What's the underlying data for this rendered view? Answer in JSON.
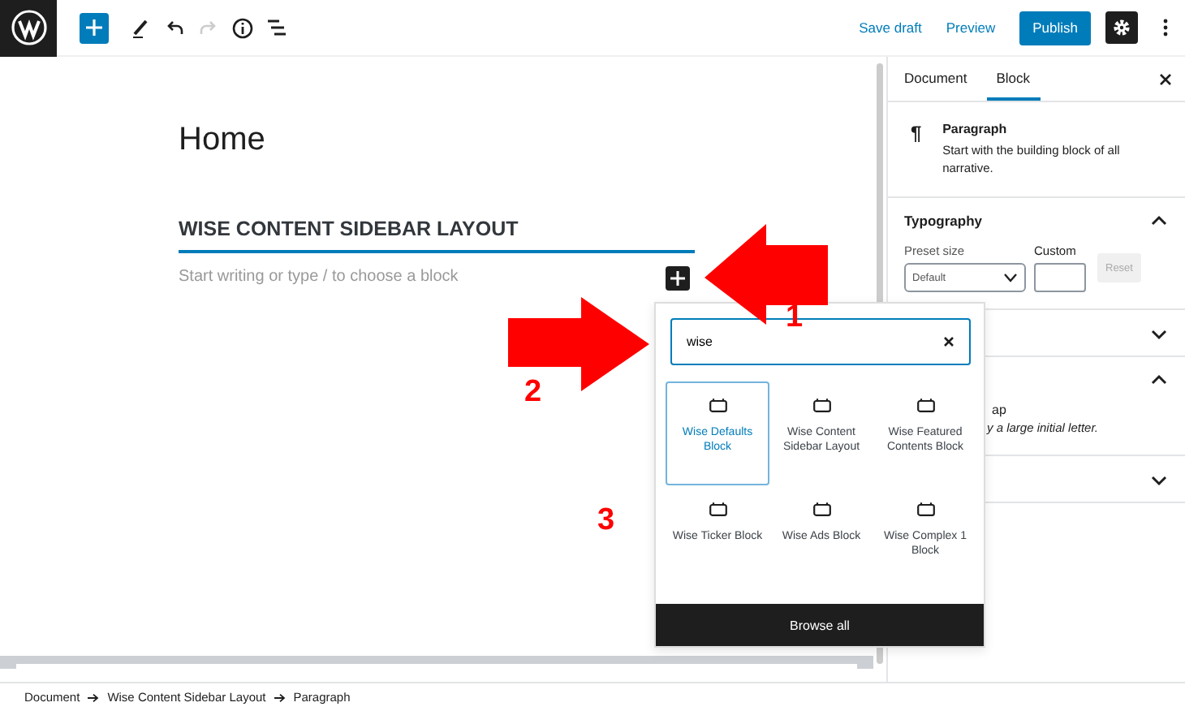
{
  "toolbar": {
    "undo_disabled": false,
    "redo_disabled": true,
    "save_draft": "Save draft",
    "preview": "Preview",
    "publish": "Publish",
    "settings_on": true
  },
  "editor": {
    "title": "Home",
    "heading": "WISE CONTENT SIDEBAR LAYOUT",
    "placeholder": "Start writing or type / to choose a block"
  },
  "inserter": {
    "search": {
      "value": "wise"
    },
    "blocks": [
      {
        "label": "Wise Defaults Block",
        "selected": true
      },
      {
        "label": "Wise Content Sidebar Layout",
        "selected": false
      },
      {
        "label": "Wise Featured Contents Block",
        "selected": false
      },
      {
        "label": "Wise Ticker Block",
        "selected": false
      },
      {
        "label": "Wise Ads Block",
        "selected": false
      },
      {
        "label": "Wise Complex 1 Block",
        "selected": false
      }
    ],
    "browse_all": "Browse all"
  },
  "sidebar": {
    "tabs": [
      {
        "label": "Document",
        "selected": false
      },
      {
        "label": "Block",
        "selected": true
      }
    ],
    "block": {
      "icon": "¶",
      "name": "Paragraph",
      "description": "Start with the building block of all narrative."
    },
    "panels": [
      {
        "kind": "typography",
        "title": "Typography",
        "expanded": true,
        "preset_label": "Preset size",
        "preset_value": "Default",
        "custom_label": "Custom",
        "reset": "Reset",
        "reset_disabled": true
      },
      {
        "kind": "plain",
        "expanded": false
      },
      {
        "kind": "toggle",
        "expanded": true,
        "toggle_label": "ap",
        "help": "y a large initial letter."
      },
      {
        "kind": "plain",
        "expanded": false
      }
    ]
  },
  "breadcrumb": [
    "Document",
    "Wise Content Sidebar Layout",
    "Paragraph"
  ],
  "annotations": [
    {
      "label": "1"
    },
    {
      "label": "2"
    },
    {
      "label": "3"
    }
  ]
}
